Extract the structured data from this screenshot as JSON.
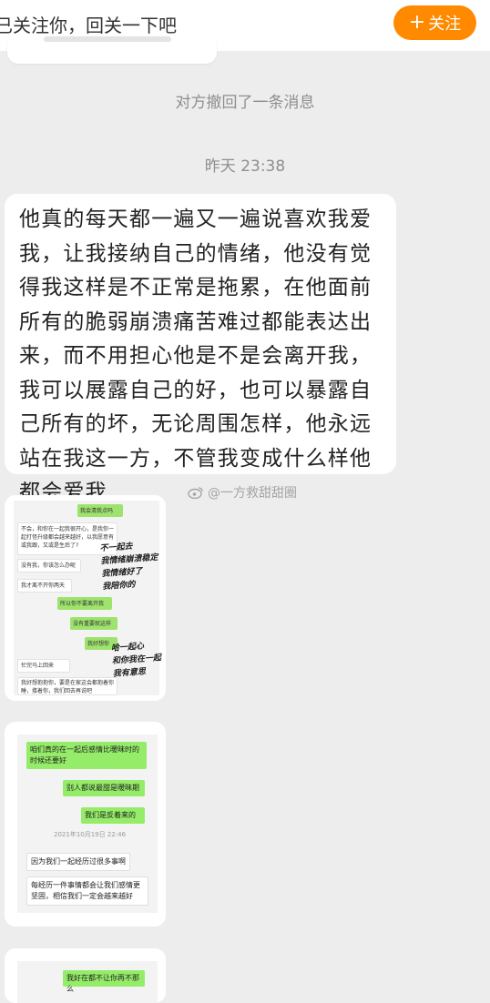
{
  "top_bar": {
    "notice": "已关注你，回关一下吧",
    "follow_label": "关注",
    "follow_color": "#ff8a00"
  },
  "system": {
    "recalled": "对方撤回了一条消息",
    "timestamp": "昨天 23:38"
  },
  "message": {
    "text": "他真的每天都一遍又一遍说喜欢我爱我，让我接纳自己的情绪，他没有觉得我这样是不正常是拖累，在他面前所有的脆弱崩溃痛苦难过都能表达出来，而不用担心他是不是会离开我，我可以展露自己的好，也可以暴露自己所有的坏，无论周围怎样，他永远站在我这一方，不管我变成什么样他都会爱我"
  },
  "watermark": "@一方救甜甜圈",
  "image1": {
    "bubbles": [
      "我会清我点吗",
      "不会，和你在一起我很开心，是我你一起打怪升级都会越来越好，以我愿意有或我跟，又或是生后了?",
      "没有我，你该怎么办呢",
      "我才离不开你两天",
      "所以你不要离开我",
      "没有重要就这样",
      "我好想你",
      "忙完马上回来",
      "我好想抱抱你，要是在家这会都抱着你睡，搂着你，我们回去再说吧"
    ],
    "note_a": "不一起去\n我情绪崩溃稳定\n我情绪好了\n我陪你的",
    "note_b": "哈一起心\n和你我在一起\n我有意思"
  },
  "image2": {
    "bubbles": [
      "咱们真的在一起后感情比暧昧时的时候还要好",
      "别人都说最甜是暧昧期",
      "我们是反着来的",
      "因为我们一起经历过很多事啊",
      "每经历一件事情都会让我们感情更坚固，相信我们一定会越来越好"
    ],
    "timestamp": "2021年10月19日 22:46"
  },
  "image3": {
    "bubble": "我好在都不让你再不那么"
  }
}
